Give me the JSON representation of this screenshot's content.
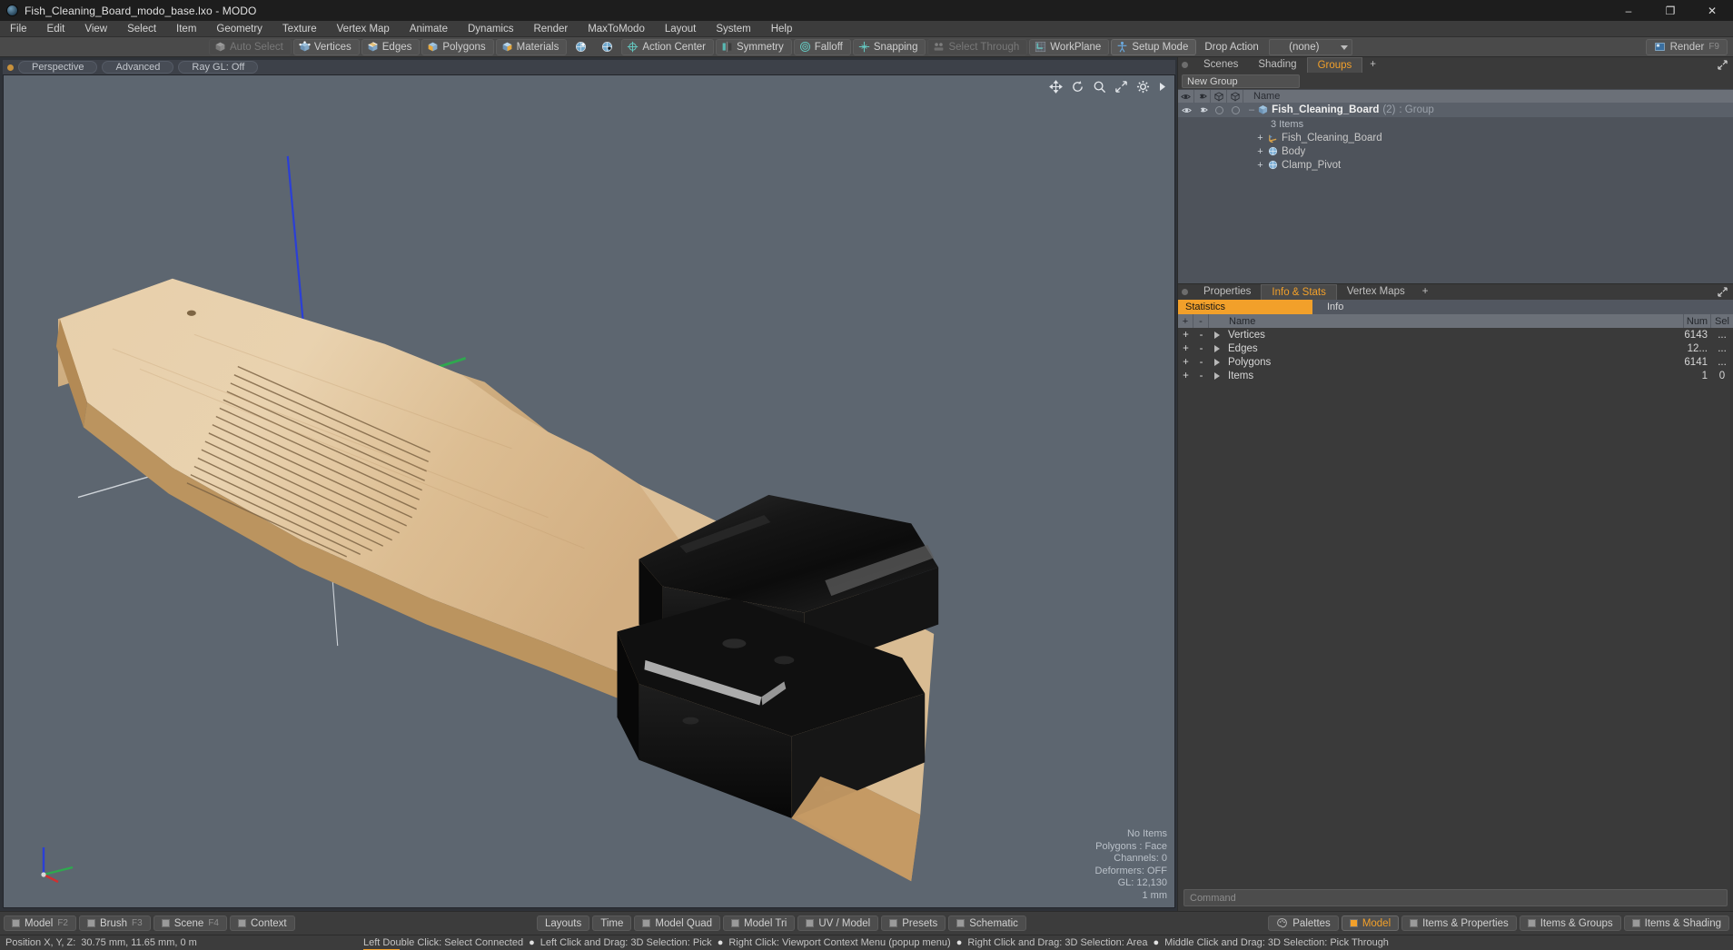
{
  "titlebar": {
    "title": "Fish_Cleaning_Board_modo_base.lxo - MODO",
    "minimize": "–",
    "maximize": "❐",
    "close": "✕"
  },
  "menubar": {
    "items": [
      "File",
      "Edit",
      "View",
      "Select",
      "Item",
      "Geometry",
      "Texture",
      "Vertex Map",
      "Animate",
      "Dynamics",
      "Render",
      "MaxToModo",
      "Layout",
      "System",
      "Help"
    ]
  },
  "toolbar": {
    "buttons": [
      {
        "label": "Auto Select",
        "icon": "cube-grey-icon",
        "state": "dim"
      },
      {
        "label": "Vertices",
        "icon": "cube-vertices-icon",
        "state": "normal"
      },
      {
        "label": "Edges",
        "icon": "cube-edges-icon",
        "state": "normal"
      },
      {
        "label": "Polygons",
        "icon": "cube-polygons-icon",
        "state": "normal"
      },
      {
        "label": "Materials",
        "icon": "cube-materials-icon",
        "state": "normal"
      }
    ],
    "icon_only": [
      "globe-center-icon",
      "globe-element-icon"
    ],
    "groups": [
      {
        "label": "Action Center",
        "icon": "action-center-icon"
      },
      {
        "label": "Symmetry",
        "icon": "symmetry-icon"
      },
      {
        "label": "Falloff",
        "icon": "falloff-icon"
      },
      {
        "label": "Snapping",
        "icon": "snapping-icon"
      },
      {
        "label": "Select Through",
        "icon": "select-through-icon",
        "state": "dim"
      },
      {
        "label": "WorkPlane",
        "icon": "workplane-icon"
      },
      {
        "label": "Setup Mode",
        "icon": "setup-mode-icon",
        "state": "sel"
      }
    ],
    "drop_action_label": "Drop Action",
    "drop_action_value": "(none)",
    "render_label": "Render",
    "render_shortcut": "F9"
  },
  "viewport": {
    "tabs": [
      "Perspective",
      "Advanced",
      "Ray GL: Off"
    ],
    "gizmos": [
      "move-icon",
      "rotate-icon",
      "zoom-icon",
      "fit-icon",
      "gear-icon",
      "chevron-right-icon"
    ],
    "stats": [
      "No Items",
      "Polygons : Face",
      "Channels: 0",
      "Deformers: OFF",
      "GL: 12,130",
      "1 mm"
    ]
  },
  "right_panel": {
    "tabs": [
      {
        "label": "Scenes",
        "active": false
      },
      {
        "label": "Shading",
        "active": false
      },
      {
        "label": "Groups",
        "active": true
      },
      {
        "label": "+",
        "active": false
      }
    ],
    "new_group_label": "New Group",
    "tree_header": {
      "columns": [
        "eye-icon",
        "render-icon",
        "shade-icon",
        "wire-icon"
      ],
      "name": "Name"
    },
    "tree_rows": [
      {
        "name": "Fish_Cleaning_Board",
        "count": "(2)",
        "suffix": ": Group",
        "type": "group",
        "icon": "group-icon",
        "indent": 0
      },
      {
        "name": "3 Items",
        "type": "subcount",
        "indent": 1
      },
      {
        "name": "Fish_Cleaning_Board",
        "type": "mesh",
        "icon": "mesh-icon",
        "indent": 1,
        "expander": "+"
      },
      {
        "name": "Body",
        "type": "item",
        "icon": "item-icon",
        "indent": 1,
        "expander": "+"
      },
      {
        "name": "Clamp_Pivot",
        "type": "item",
        "icon": "item-icon",
        "indent": 1,
        "expander": "+"
      }
    ]
  },
  "stats_panel": {
    "tabs": [
      {
        "label": "Properties",
        "active": false
      },
      {
        "label": "Info & Stats",
        "active": true
      },
      {
        "label": "Vertex Maps",
        "active": false
      },
      {
        "label": "+",
        "active": false
      }
    ],
    "subtabs": [
      {
        "label": "Statistics",
        "active": true
      },
      {
        "label": "Info",
        "active": false
      }
    ],
    "headers": [
      "+",
      "-",
      "Name",
      "Num",
      "Sel"
    ],
    "rows": [
      {
        "plus": "+",
        "minus": "-",
        "name": "Vertices",
        "num": "6143",
        "sel": "..."
      },
      {
        "plus": "+",
        "minus": "-",
        "name": "Edges",
        "num": "12...",
        "sel": "..."
      },
      {
        "plus": "+",
        "minus": "-",
        "name": "Polygons",
        "num": "6141",
        "sel": "..."
      },
      {
        "plus": "+",
        "minus": "-",
        "name": "Items",
        "num": "1",
        "sel": "0"
      }
    ],
    "command_placeholder": "Command"
  },
  "bottom_bar": {
    "left": [
      {
        "label": "Model",
        "fkey": "F2",
        "icon": "mode-swatch"
      },
      {
        "label": "Brush",
        "fkey": "F3",
        "icon": "mode-swatch"
      },
      {
        "label": "Scene",
        "fkey": "F4",
        "icon": "mode-swatch"
      },
      {
        "label": "Context",
        "fkey": "",
        "icon": "mode-swatch"
      }
    ],
    "center": [
      {
        "label": "Layouts"
      },
      {
        "label": "Time"
      },
      {
        "label": "Model Quad",
        "icon": "mode-swatch"
      },
      {
        "label": "Model Tri",
        "icon": "mode-swatch"
      },
      {
        "label": "UV / Model",
        "icon": "mode-swatch"
      },
      {
        "label": "Presets",
        "icon": "mode-swatch"
      },
      {
        "label": "Schematic",
        "icon": "mode-swatch"
      }
    ],
    "right": [
      {
        "label": "Palettes",
        "icon": "palette-icon"
      },
      {
        "label": "Model",
        "icon": "mode-swatch-orange",
        "active": true
      },
      {
        "label": "Items & Properties",
        "icon": "mode-swatch"
      },
      {
        "label": "Items & Groups",
        "icon": "mode-swatch"
      },
      {
        "label": "Items & Shading",
        "icon": "mode-swatch"
      }
    ]
  },
  "statusbar": {
    "position_label": "Position X, Y, Z:",
    "position_value": "30.75 mm, 11.65 mm, 0 m",
    "hints": [
      "Left Double Click: Select Connected",
      "Left Click and Drag: 3D Selection: Pick",
      "Right Click: Viewport Context Menu (popup menu)",
      "Right Click and Drag: 3D Selection: Area",
      "Middle Click and Drag: 3D Selection: Pick Through"
    ]
  },
  "colors": {
    "accent_orange": "#f2a02a",
    "viewport_bg": "#5d6670",
    "wood_light": "#e9cfa8",
    "wood_mid": "#d8b98c",
    "wood_dark": "#c2a273",
    "clamp_black": "#0d0d0d",
    "axis_y": "#2b3fd6",
    "axis_x": "#d8d8d8",
    "axis_z": "#2fa84f"
  }
}
